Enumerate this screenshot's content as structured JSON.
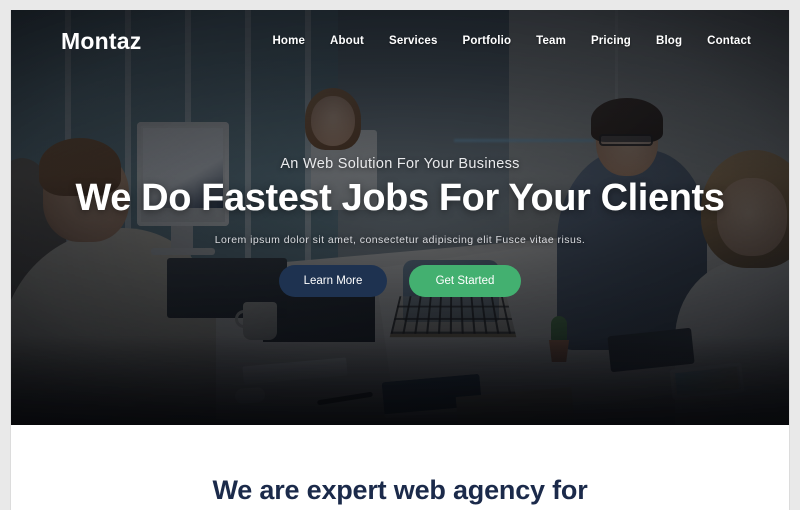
{
  "site": {
    "logo_text": "Montaz"
  },
  "nav": {
    "items": [
      {
        "label": "Home"
      },
      {
        "label": "About"
      },
      {
        "label": "Services"
      },
      {
        "label": "Portfolio"
      },
      {
        "label": "Team"
      },
      {
        "label": "Pricing"
      },
      {
        "label": "Blog"
      },
      {
        "label": "Contact"
      }
    ]
  },
  "hero": {
    "eyebrow": "An Web Solution For Your Business",
    "title": "We Do Fastest Jobs For Your Clients",
    "subtitle": "Lorem ipsum dolor sit amet, consectetur adipiscing elit Fusce vitae risus.",
    "primary_button": "Learn More",
    "accent_button": "Get Started",
    "background_description": "Office team working at a long white conference table with monitors, laptops and a small potted plant"
  },
  "intro_section": {
    "heading": "We are expert web agency for"
  },
  "colors": {
    "accent_green": "#43b070",
    "dark_navy": "#1e3250",
    "heading_navy": "#1b2a4a",
    "text_white": "#ffffff",
    "page_background": "#ffffff",
    "canvas_background": "#e9e9e9"
  }
}
